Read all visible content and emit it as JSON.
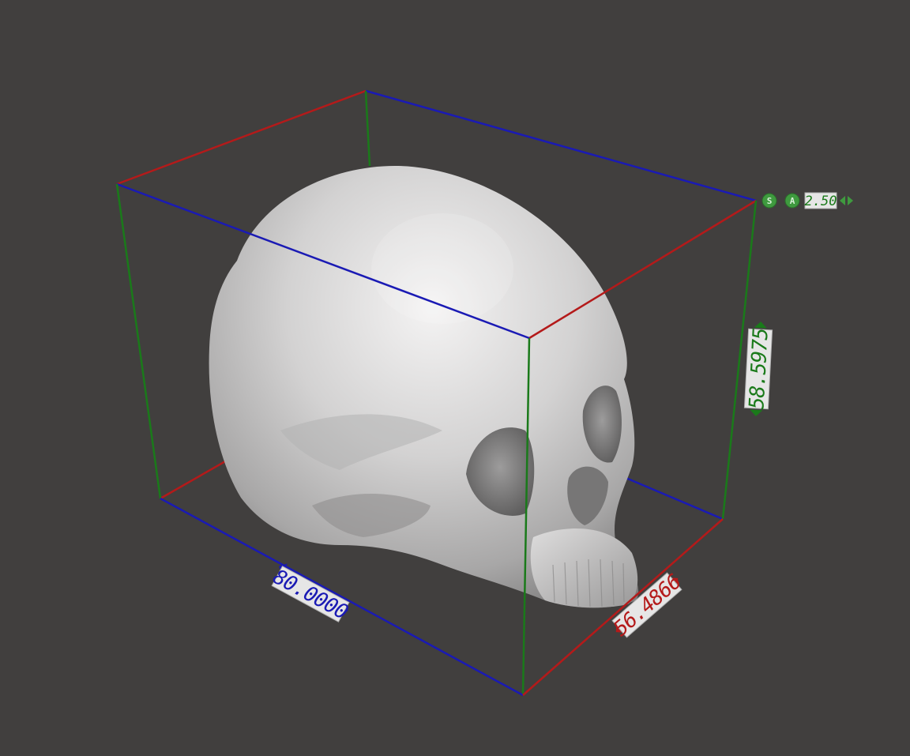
{
  "viewport": {
    "background": "#413f3e",
    "object_icon_name": "skull-mesh",
    "bbox_colors": {
      "x_axis": "#1a1ab4",
      "y_axis": "#b41a1a",
      "z_axis": "#1a7a1a"
    }
  },
  "dimensions": {
    "width_label": "80.0000",
    "depth_label": "56.4866",
    "height_label": "58.5975"
  },
  "controls": {
    "scale_button": "S",
    "auto_button": "A",
    "step_value": "2.50",
    "arrow_left_icon": "triangle-left-icon",
    "arrow_right_icon": "triangle-right-icon"
  }
}
